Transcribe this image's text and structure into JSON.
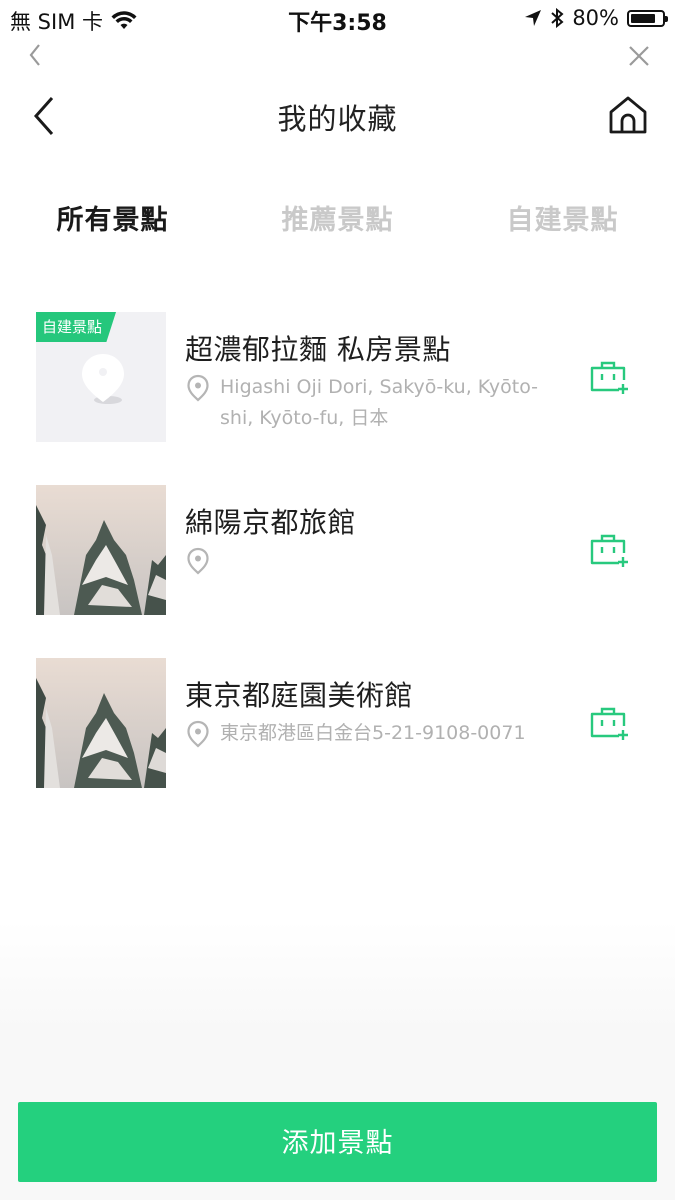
{
  "status_bar": {
    "carrier": "無 SIM 卡",
    "time": "下午3:58",
    "battery": "80%",
    "battery_level": 0.8
  },
  "header": {
    "title": "我的收藏"
  },
  "tabs": [
    {
      "label": "所有景點",
      "active": true
    },
    {
      "label": "推薦景點",
      "active": false
    },
    {
      "label": "自建景點",
      "active": false
    }
  ],
  "items": [
    {
      "badge": "自建景點",
      "title": "超濃郁拉麵 私房景點",
      "address": "Higashi Oji Dori, Sakyō-ku, Kyōto-shi, Kyōto-fu, 日本",
      "thumbnail": "custom-placeholder"
    },
    {
      "title": "綿陽京都旅館",
      "address": "",
      "thumbnail": "snowy-forest-photo"
    },
    {
      "title": "東京都庭園美術館",
      "address": "東京都港區白金台5-21-9108-0071",
      "thumbnail": "snowy-forest-photo"
    }
  ],
  "bottom": {
    "add_button_label": "添加景點"
  },
  "icons": {
    "browser_back": "chevron-left-icon",
    "browser_close": "close-icon",
    "back": "back-arrow-icon",
    "home": "home-icon",
    "location": "location-pin-icon",
    "add_to_trip": "luggage-add-icon"
  },
  "colors": {
    "accent": "#24d07e",
    "inactive_tab": "#c9c9c9",
    "address_text": "#b1b1b1"
  }
}
